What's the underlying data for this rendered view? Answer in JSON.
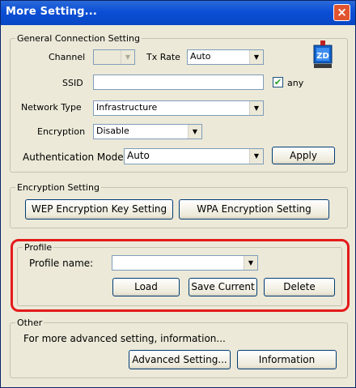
{
  "window": {
    "title": "More Setting...",
    "close_glyph": "×"
  },
  "general": {
    "legend": "General Connection Setting",
    "channel_label": "Channel",
    "channel_value": "",
    "txrate_label": "Tx Rate",
    "txrate_value": "Auto",
    "ssid_label": "SSID",
    "ssid_value": "",
    "any_label": "any",
    "any_checked": true,
    "network_type_label": "Network Type",
    "network_type_value": "Infrastructure",
    "encryption_label": "Encryption",
    "encryption_value": "Disable",
    "auth_label": "Authentication Mode",
    "auth_value": "Auto",
    "apply_label": "Apply",
    "logo_icon": "zd-wireless-icon"
  },
  "encryption_setting": {
    "legend": "Encryption Setting",
    "wep_button": "WEP Encryption Key Setting",
    "wpa_button": "WPA Encryption Setting"
  },
  "profile": {
    "legend": "Profile",
    "name_label": "Profile name:",
    "name_value": "",
    "load_button": "Load",
    "save_button": "Save Current",
    "delete_button": "Delete",
    "highlight_color": "#e41a1a"
  },
  "other": {
    "legend": "Other",
    "description": "For more advanced setting, information...",
    "advanced_button": "Advanced Setting...",
    "info_button": "Information"
  },
  "colors": {
    "titlebar": "#0b4fd6",
    "dialog_bg": "#ece9d8",
    "highlight": "#e41a1a"
  }
}
